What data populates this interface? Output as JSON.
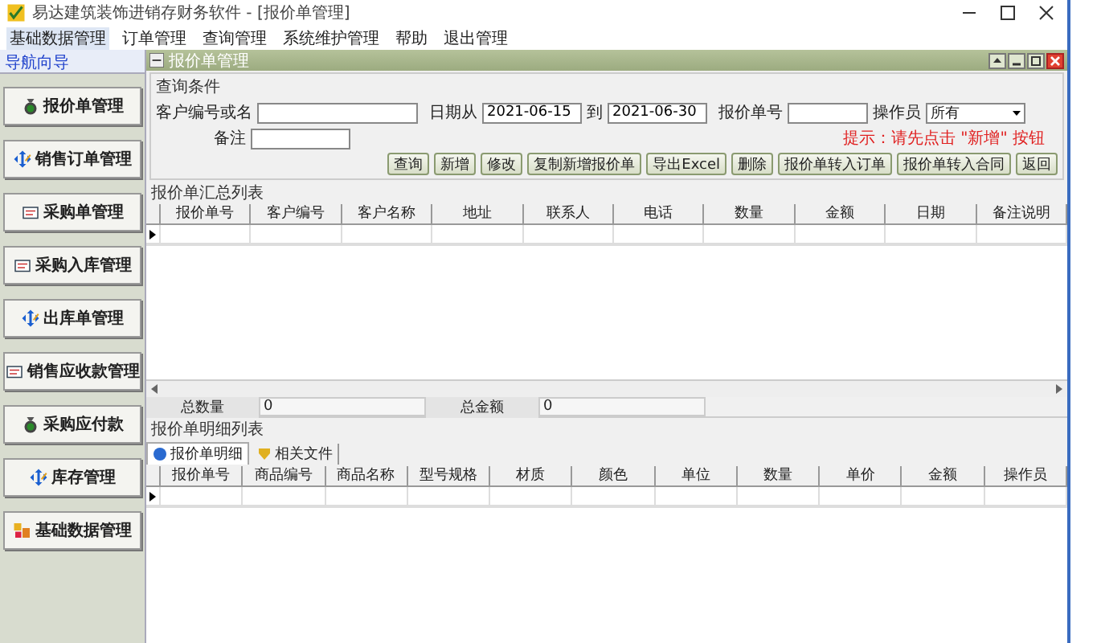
{
  "window": {
    "title": "易达建筑装饰进销存财务软件 - [报价单管理]"
  },
  "menu": [
    {
      "label": "基础数据管理",
      "selected": true
    },
    {
      "label": "订单管理",
      "selected": false
    },
    {
      "label": "查询管理",
      "selected": false
    },
    {
      "label": "系统维护管理",
      "selected": false
    },
    {
      "label": "帮助",
      "selected": false
    },
    {
      "label": "退出管理",
      "selected": false
    }
  ],
  "sidebar": {
    "title": "导航向导",
    "items": [
      {
        "label": "报价单管理"
      },
      {
        "label": "销售订单管理"
      },
      {
        "label": "采购单管理"
      },
      {
        "label": "采购入库管理"
      },
      {
        "label": "出库单管理"
      },
      {
        "label": "销售应收款管理"
      },
      {
        "label": "采购应付款"
      },
      {
        "label": "库存管理"
      },
      {
        "label": "基础数据管理"
      }
    ]
  },
  "child_window": {
    "title": "报价单管理"
  },
  "query": {
    "title": "查询条件",
    "customer_label": "客户编号或名",
    "date_from_label": "日期从",
    "date_from": "2021-06-15",
    "date_to_label": "到",
    "date_to": "2021-06-30",
    "quote_no_label": "报价单号",
    "operator_label": "操作员",
    "operator": "所有",
    "note_label": "备注",
    "hint": "提示：请先点击 \"新增\" 按钮"
  },
  "buttons": [
    "查询",
    "新增",
    "修改",
    "复制新增报价单",
    "导出Excel",
    "删除",
    "报价单转入订单",
    "报价单转入合同",
    "返回"
  ],
  "summary": {
    "title": "报价单汇总列表",
    "columns": [
      "报价单号",
      "客户编号",
      "客户名称",
      "地址",
      "联系人",
      "电话",
      "数量",
      "金额",
      "日期",
      "备注说明"
    ]
  },
  "totals": [
    {
      "label": "总数量",
      "value": "0"
    },
    {
      "label": "总金额",
      "value": "0"
    }
  ],
  "detail": {
    "title": "报价单明细列表",
    "tabs": [
      {
        "label": "报价单明细",
        "selected": true
      },
      {
        "label": "相关文件",
        "selected": false
      }
    ],
    "columns": [
      "报价单号",
      "商品编号",
      "商品名称",
      "型号规格",
      "材质",
      "颜色",
      "单位",
      "数量",
      "单价",
      "金额",
      "操作员"
    ]
  }
}
